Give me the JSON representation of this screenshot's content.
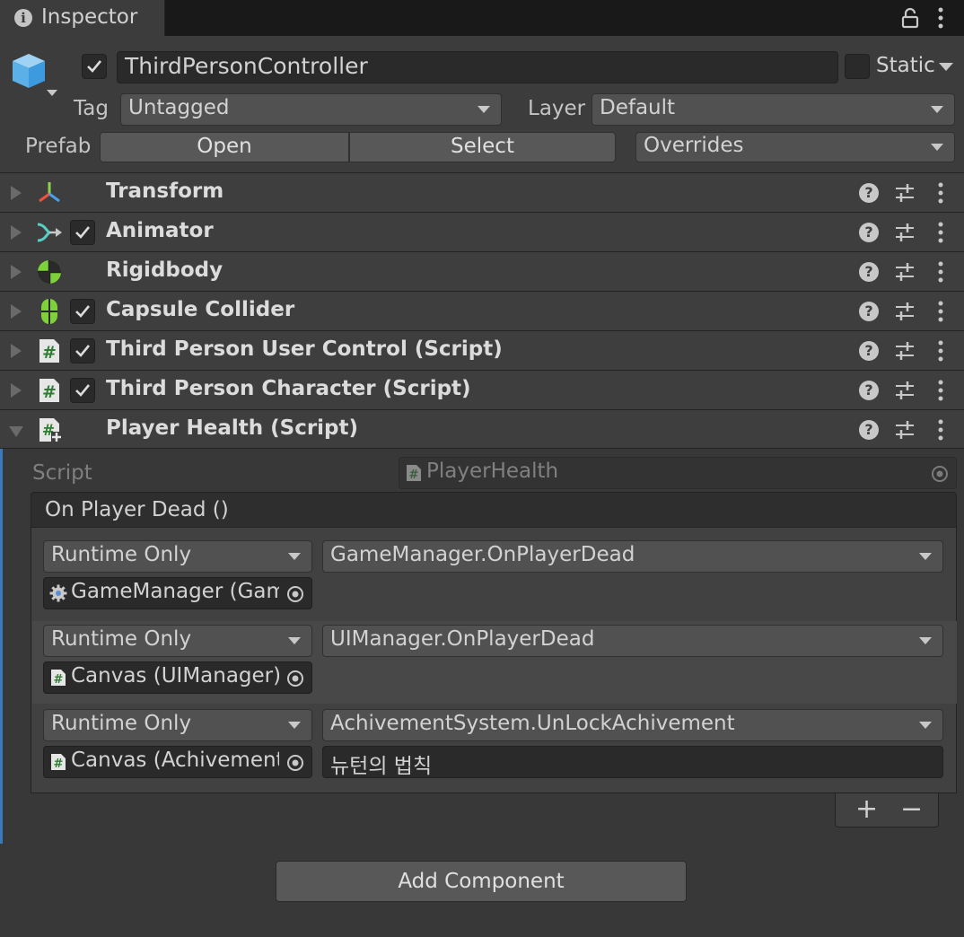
{
  "tab": {
    "title": "Inspector"
  },
  "header": {
    "active": true,
    "object_name": "ThirdPersonController",
    "static_label": "Static",
    "tag_label": "Tag",
    "tag_value": "Untagged",
    "layer_label": "Layer",
    "layer_value": "Default",
    "prefab_label": "Prefab",
    "open_label": "Open",
    "select_label": "Select",
    "overrides_label": "Overrides"
  },
  "components": [
    {
      "name": "Transform",
      "icon": "transform-icon",
      "has_checkbox": false,
      "expanded": false
    },
    {
      "name": "Animator",
      "icon": "animator-icon",
      "has_checkbox": true,
      "expanded": false
    },
    {
      "name": "Rigidbody",
      "icon": "rigidbody-icon",
      "has_checkbox": false,
      "expanded": false
    },
    {
      "name": "Capsule Collider",
      "icon": "capsule-collider-icon",
      "has_checkbox": true,
      "expanded": false
    },
    {
      "name": "Third Person User Control (Script)",
      "icon": "script-icon",
      "has_checkbox": true,
      "expanded": false
    },
    {
      "name": "Third Person Character (Script)",
      "icon": "script-icon",
      "has_checkbox": true,
      "expanded": false
    },
    {
      "name": "Player Health (Script)",
      "icon": "script-added-icon",
      "has_checkbox": false,
      "expanded": true
    }
  ],
  "player_health": {
    "script_label": "Script",
    "script_value": "PlayerHealth",
    "event_title": "On Player Dead ()",
    "listeners": [
      {
        "mode": "Runtime Only",
        "function": "GameManager.OnPlayerDead",
        "target": "GameManager (Gam",
        "target_icon": "gear-icon",
        "argument": null
      },
      {
        "mode": "Runtime Only",
        "function": "UIManager.OnPlayerDead",
        "target": "Canvas (UIManager)",
        "target_icon": "script-icon",
        "argument": null
      },
      {
        "mode": "Runtime Only",
        "function": "AchivementSystem.UnLockAchivement",
        "target": "Canvas (Achivement",
        "target_icon": "script-icon",
        "argument": "뉴턴의 법칙"
      }
    ],
    "add_symbol": "+",
    "remove_symbol": "−"
  },
  "add_component_label": "Add Component",
  "colors": {
    "accent": "#3a79bb",
    "panel": "#383838",
    "header": "#3c3c3c",
    "field": "#2a2a2a"
  }
}
